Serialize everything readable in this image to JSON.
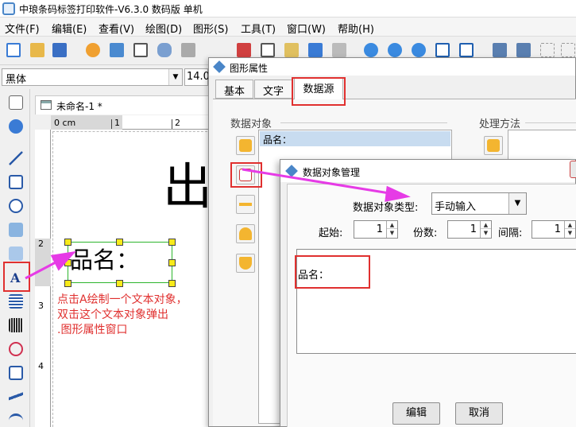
{
  "window": {
    "title": "中琅条码标签打印软件-V6.3.0 数码版 单机"
  },
  "menu": [
    "文件(F)",
    "编辑(E)",
    "查看(V)",
    "绘图(D)",
    "图形(S)",
    "工具(T)",
    "窗口(W)",
    "帮助(H)"
  ],
  "font": {
    "family": "黑体",
    "size": "14.0"
  },
  "document": {
    "tab_title": "未命名-1 *",
    "ruler_h_label": "0 cm",
    "ruler_h_numbers": [
      "1",
      "2"
    ],
    "ruler_v_numbers": [
      "2",
      "3",
      "4"
    ],
    "big_char": "出",
    "label_text": "品名：",
    "annotation": [
      "点击A绘制一个文本对象，",
      "双击这个文本对象弹出",
      ".图形属性窗口"
    ]
  },
  "properties_dialog": {
    "title": "图形属性",
    "tabs": [
      "基本",
      "文字",
      "数据源"
    ],
    "data_objects_label": "数据对象",
    "processing_label": "处理方法",
    "object_item": "品名："
  },
  "manager_dialog": {
    "title": "数据对象管理",
    "type_label": "数据对象类型:",
    "type_value": "手动输入",
    "start_label": "起始:",
    "start_value": "1",
    "copies_label": "份数:",
    "copies_value": "1",
    "interval_label": "间隔:",
    "interval_value": "1",
    "content": "品名：",
    "edit_button": "编辑",
    "cancel_button": "取消"
  },
  "colors": {
    "highlight": "#e0302f",
    "arrow": "#e63be6",
    "selection": "#2db52d",
    "handle": "#f7ea1a"
  }
}
